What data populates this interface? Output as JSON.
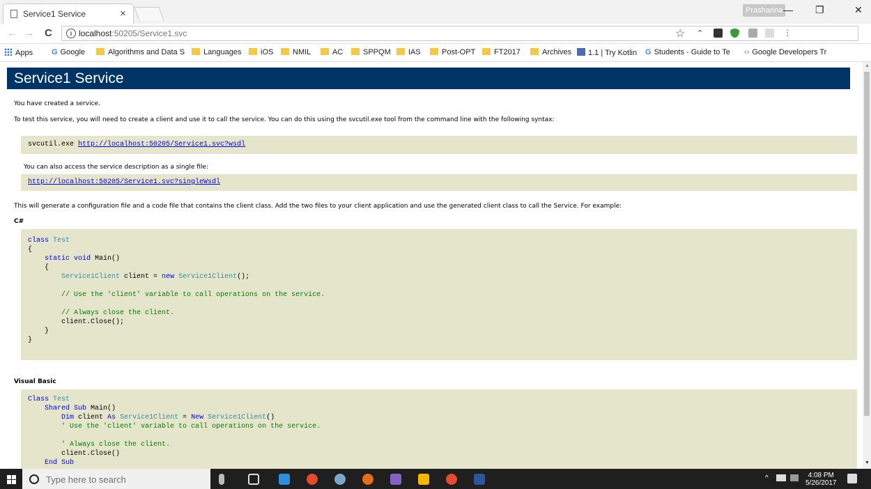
{
  "browser": {
    "tab_title": "Service1 Service",
    "tab_close": "×",
    "profile": "Prasharina",
    "win_min": "—",
    "win_max": "❐",
    "win_close": "✕",
    "url_host": "localhost",
    "url_rest": ":50205/Service1.svc",
    "nav_back": "←",
    "nav_forward": "→",
    "nav_reload": "C",
    "star": "☆"
  },
  "bookmarks": [
    "Apps",
    "Google",
    "Algorithms and Data S",
    "Languages",
    "iOS",
    "NMIL",
    "AC",
    "SPPQM",
    "IAS",
    "Post-OPT",
    "FT2017",
    "Archives",
    "1.1 | Try Kotlin",
    "Students - Guide to Te",
    "Google Developers Tr"
  ],
  "page": {
    "heading": "Service1 Service",
    "p_created": "You have created a service.",
    "p_test": "To test this service, you will need to create a client and use it to call the service. You can do this using the svcutil.exe tool from the command line with the following syntax:",
    "svcutil_cmd": "svcutil.exe ",
    "wsdl_link": "http://localhost:50205/Service1.svc?wsdl",
    "p_single": "You can also access the service description as a single file:",
    "single_link": "http://localhost:50205/Service1.svc?singleWsdl",
    "p_generate": "This will generate a configuration file and a code file that contains the client class. Add the two files to your client application and use the generated client class to call the Service. For example:",
    "label_cs": "C#",
    "label_vb": "Visual Basic"
  },
  "code": {
    "cs_class": "class",
    "cs_test": " Test",
    "cs_brace_open": "{",
    "cs_brace_close": "}",
    "cs_static": "static",
    "cs_void": " void",
    "cs_main": " Main()",
    "cs_inner_open": "{",
    "cs_inner_close": "}",
    "cs_type": "Service1Client",
    "cs_client": " client = ",
    "cs_new": "new",
    "cs_type2": " Service1Client",
    "cs_end": "();",
    "cs_comment1": "// Use the 'client' variable to call operations on the service.",
    "cs_comment2": "// Always close the client.",
    "cs_close": "client.Close();",
    "vb_class": "Class",
    "vb_test": " Test",
    "vb_shared": "Shared",
    "vb_sub": " Sub",
    "vb_main": " Main()",
    "vb_dim": "Dim",
    "vb_client": " client ",
    "vb_as": "As",
    "vb_type": " Service1Client",
    "vb_eq": " = ",
    "vb_new": "New",
    "vb_type2": " Service1Client",
    "vb_paren": "()",
    "vb_comment1": "' Use the 'client' variable to call operations on the service.",
    "vb_comment2": "' Always close the client.",
    "vb_close": "client.Close()",
    "vb_endsub": "End Sub"
  },
  "taskbar": {
    "search_placeholder": "Type here to search",
    "time": "4:08 PM",
    "date": "5/26/2017",
    "tray_up": "^"
  },
  "colors": {
    "heading_bg": "#003366",
    "code_bg": "#e5e5cc",
    "keyword": "#0000ff",
    "type": "#2b91af",
    "comment": "#008000"
  }
}
